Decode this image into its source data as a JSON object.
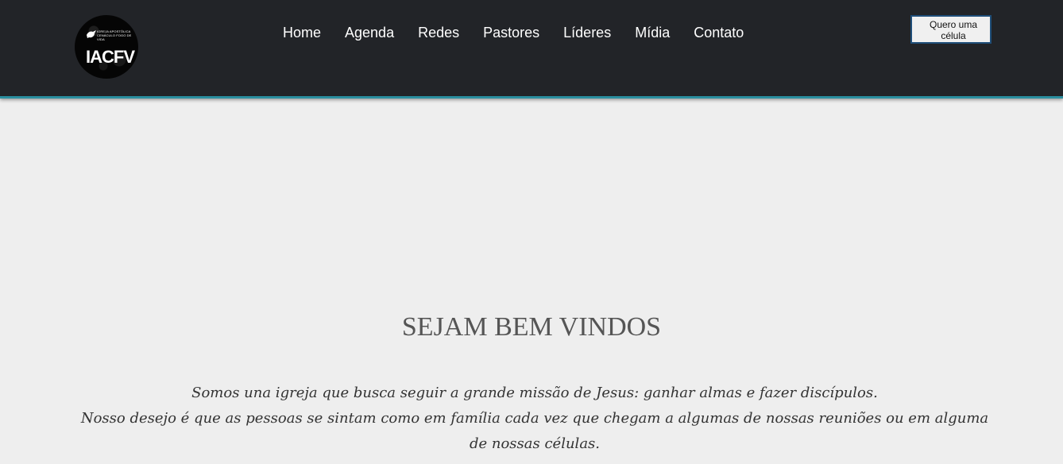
{
  "header": {
    "logo": {
      "small_text": "IGREJA APOSTÓLICA CENÁCULO FOGO DE VIDA",
      "big_text": "IACFV"
    },
    "nav": [
      {
        "label": "Home"
      },
      {
        "label": "Agenda"
      },
      {
        "label": "Redes"
      },
      {
        "label": "Pastores"
      },
      {
        "label": "Líderes"
      },
      {
        "label": "Mídia"
      },
      {
        "label": "Contato"
      }
    ],
    "cta_label": "Quero uma célula"
  },
  "main": {
    "title": "SEJAM BEM VINDOS",
    "paragraph_1": "Somos una igreja que busca seguir a grande missão de Jesus: ganhar almas e fazer discípulos.",
    "paragraph_2": "Nosso desejo é que as pessoas se sintam como em família cada vez que chegam a algumas de nossas reuniões ou em alguma de nossas células."
  },
  "colors": {
    "header_bg": "#222428",
    "header_border": "#2a8fa0",
    "page_bg": "#eeeeee",
    "cta_border": "#1f4e79"
  }
}
